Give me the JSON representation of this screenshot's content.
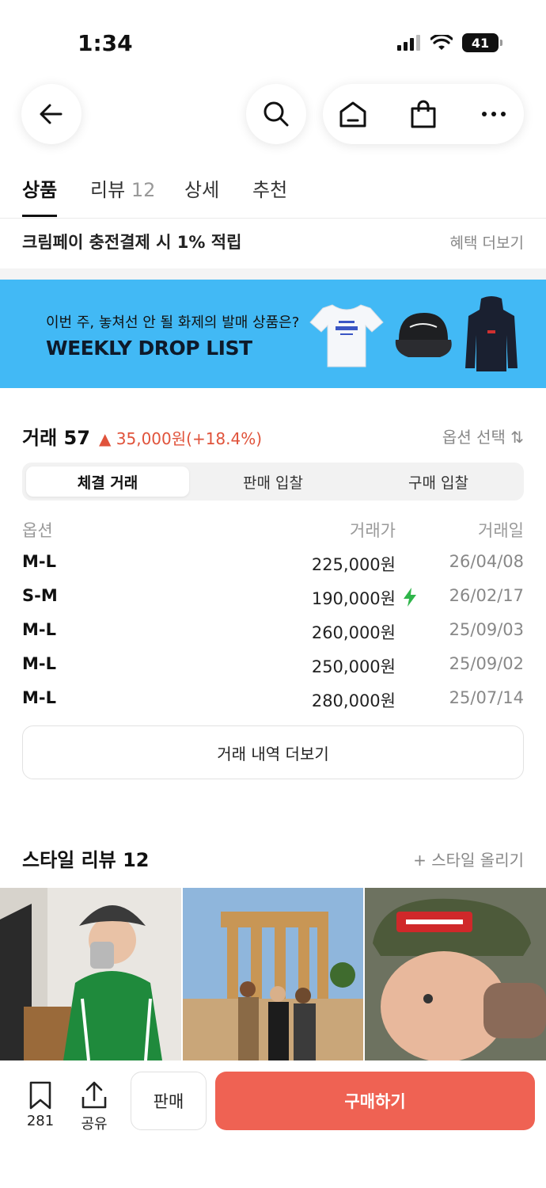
{
  "status": {
    "time": "1:34",
    "battery": "41"
  },
  "nav": {
    "icons": [
      "back-arrow-icon",
      "search-icon",
      "home-icon",
      "shopping-bag-icon",
      "more-icon"
    ]
  },
  "tabs": [
    {
      "label": "상품",
      "count": ""
    },
    {
      "label": "리뷰",
      "count": "12"
    },
    {
      "label": "상세",
      "count": ""
    },
    {
      "label": "추천",
      "count": ""
    }
  ],
  "promo": {
    "text": "크림페이 충전결제 시 1% 적립",
    "link": "혜택 더보기"
  },
  "banner": {
    "subtitle": "이번 주, 놓쳐선 안 될 화제의 발매 상품은?",
    "title": "WEEKLY DROP LIST",
    "bg_color": "#42b9f5"
  },
  "trades": {
    "title": "거래",
    "count": "57",
    "change": "▲ 35,000원(+18.4%)",
    "change_color": "#e0533b",
    "option_select": "옵션 선택 ⇅",
    "segments": [
      "체결 거래",
      "판매 입찰",
      "구매 입찰"
    ],
    "columns": [
      "옵션",
      "거래가",
      "거래일"
    ],
    "rows": [
      {
        "option": "M-L",
        "price": "225,000원",
        "date": "26/04/08",
        "quick": false
      },
      {
        "option": "S-M",
        "price": "190,000원",
        "date": "26/02/17",
        "quick": true
      },
      {
        "option": "M-L",
        "price": "260,000원",
        "date": "25/09/03",
        "quick": false
      },
      {
        "option": "M-L",
        "price": "250,000원",
        "date": "25/09/02",
        "quick": false
      },
      {
        "option": "M-L",
        "price": "280,000원",
        "date": "25/07/14",
        "quick": false
      }
    ],
    "more_label": "거래 내역 더보기"
  },
  "style_reviews": {
    "title": "스타일 리뷰 12",
    "upload": "+ 스타일 올리기"
  },
  "bottom": {
    "bookmark_count": "281",
    "share_label": "공유",
    "sell_label": "판매",
    "buy_label": "구매하기",
    "buy_color": "#ef6253"
  }
}
